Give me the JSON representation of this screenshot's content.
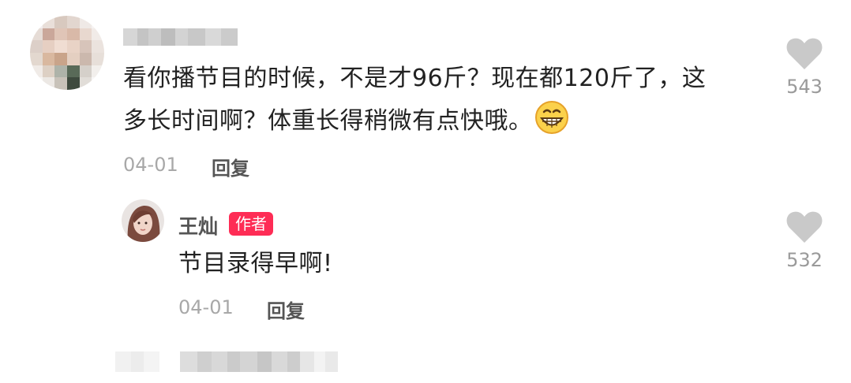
{
  "comments": [
    {
      "username": "",
      "text_line1": "看你播节目的时候，不是才96斤？现在都120斤了，这",
      "text_line2": "多长时间啊？体重长得稍微有点快哦。",
      "emoji": "grinning-face-emoji",
      "date": "04-01",
      "reply_label": "回复",
      "like_count": "543",
      "replies": [
        {
          "username": "王灿",
          "badge": "作者",
          "text": "节目录得早啊!",
          "date": "04-01",
          "reply_label": "回复",
          "like_count": "532"
        }
      ]
    }
  ],
  "colors": {
    "badge_bg": "#fe2c55",
    "heart": "#c9c9c9",
    "text": "#222222",
    "meta": "#a8a8a8"
  }
}
